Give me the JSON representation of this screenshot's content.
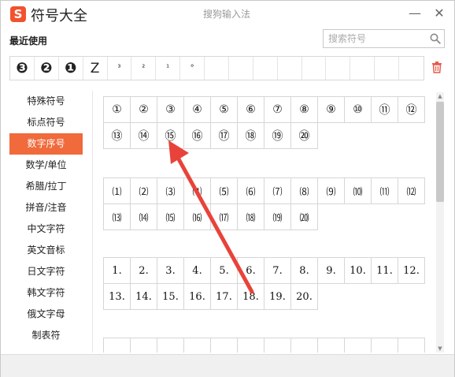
{
  "window": {
    "logo_text": "S",
    "app_title": "符号大全",
    "center_title": "搜狗输入法",
    "minimize_glyph": "—",
    "close_glyph": "✕"
  },
  "recent": {
    "title": "最近使用",
    "search_placeholder": "搜索符号",
    "items": [
      "❸",
      "❷",
      "❶",
      "Z",
      "³",
      "²",
      "¹",
      "°"
    ]
  },
  "sidebar": {
    "items": [
      {
        "label": "特殊符号",
        "active": false
      },
      {
        "label": "标点符号",
        "active": false
      },
      {
        "label": "数字序号",
        "active": true
      },
      {
        "label": "数学/单位",
        "active": false
      },
      {
        "label": "希腊/拉丁",
        "active": false
      },
      {
        "label": "拼音/注音",
        "active": false
      },
      {
        "label": "中文字符",
        "active": false
      },
      {
        "label": "英文音标",
        "active": false
      },
      {
        "label": "日文字符",
        "active": false
      },
      {
        "label": "韩文字符",
        "active": false
      },
      {
        "label": "俄文字母",
        "active": false
      },
      {
        "label": "制表符",
        "active": false
      }
    ]
  },
  "symbols": {
    "circled": [
      "①",
      "②",
      "③",
      "④",
      "⑤",
      "⑥",
      "⑦",
      "⑧",
      "⑨",
      "⑩",
      "⑪",
      "⑫",
      "⑬",
      "⑭",
      "⑮",
      "⑯",
      "⑰",
      "⑱",
      "⑲",
      "⑳"
    ],
    "parenthesized": [
      "⑴",
      "⑵",
      "⑶",
      "⑷",
      "⑸",
      "⑹",
      "⑺",
      "⑻",
      "⑼",
      "⑽",
      "⑾",
      "⑿",
      "⒀",
      "⒁",
      "⒂",
      "⒃",
      "⒄",
      "⒅",
      "⒆",
      "⒇"
    ],
    "period": [
      "1.",
      "2.",
      "3.",
      "4.",
      "5.",
      "6.",
      "7.",
      "8.",
      "9.",
      "10.",
      "11.",
      "12.",
      "13.",
      "14.",
      "15.",
      "16.",
      "17.",
      "18.",
      "19.",
      "20."
    ]
  },
  "colors": {
    "accent": "#f06a3c",
    "logo": "#f2522e",
    "annotation_arrow": "#e8433a"
  }
}
